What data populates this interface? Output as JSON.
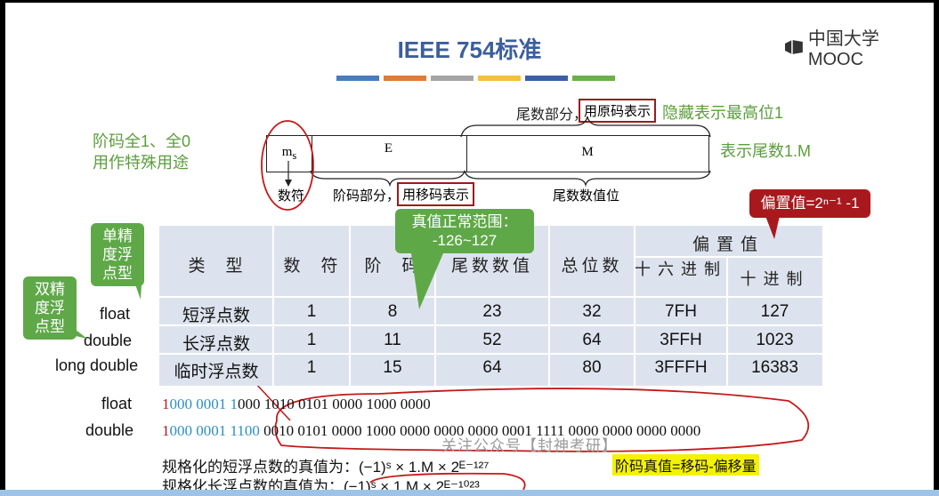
{
  "title": "IEEE 754标准",
  "logo": {
    "text": "中国大学MOOC"
  },
  "color_bars": [
    "#4a7bbd",
    "#e07b39",
    "#a5a5a5",
    "#f2c23a",
    "#3d5fa5",
    "#6cb04a"
  ],
  "labels": {
    "special_use": [
      "阶码全1、全0",
      "用作特殊用途"
    ],
    "hidden_bit": "隐藏表示最高位1",
    "represent_mantissa": "表示尾数1.M",
    "sign_label": "数符",
    "exponent_part": "阶码部分，",
    "exponent_box": "用移码表示",
    "mantissa_part": "尾数部分，",
    "mantissa_box": "用原码表示",
    "mantissa_value": "尾数数值位",
    "field_ms": "m",
    "field_ms_sub": "s",
    "field_E": "E",
    "field_M": "M"
  },
  "callouts": {
    "single": [
      "单精",
      "度浮",
      "点型"
    ],
    "double": [
      "双精",
      "度浮",
      "点型"
    ],
    "range": [
      "真值正常范围：",
      "-126~127"
    ],
    "bias": "偏置值=2ⁿ⁻¹ -1"
  },
  "table": {
    "headers": [
      "类　型",
      "数　符",
      "阶　码",
      "尾数数值",
      "总位数"
    ],
    "bias_header": "偏置值",
    "bias_sub": [
      "十六进制",
      "十进制"
    ],
    "row_labels": [
      "float",
      "double",
      "long double"
    ],
    "rows": [
      [
        "短浮点数",
        "1",
        "8",
        "23",
        "32",
        "7FH",
        "127"
      ],
      [
        "长浮点数",
        "1",
        "11",
        "52",
        "64",
        "3FFH",
        "1023"
      ],
      [
        "临时浮点数",
        "1",
        "15",
        "64",
        "80",
        "3FFFH",
        "16383"
      ]
    ]
  },
  "bits": {
    "float_label": "float",
    "double_label": "double",
    "float": {
      "sign": "1",
      "exp": "000 0001 1",
      "mant": "000 1010 0101 0000 1000 0000"
    },
    "double": {
      "sign": "1",
      "exp": "000 0001 1100 ",
      "mant": "0010 0101 0000 1000 0000 0000 0000 0001 1111 0000 0000 0000 0000"
    }
  },
  "formulas": {
    "short": "规格化的短浮点数的真值为：(−1)ˢ × 1.M × 2ᴱ⁻¹²⁷",
    "long": "规格化长浮点数的真值为：(−1)ˢ × 1.M × 2ᴱ⁻¹⁰²³",
    "note": "阶码真值=移码-偏移量"
  },
  "watermark": "关注公众号【封神考研】"
}
